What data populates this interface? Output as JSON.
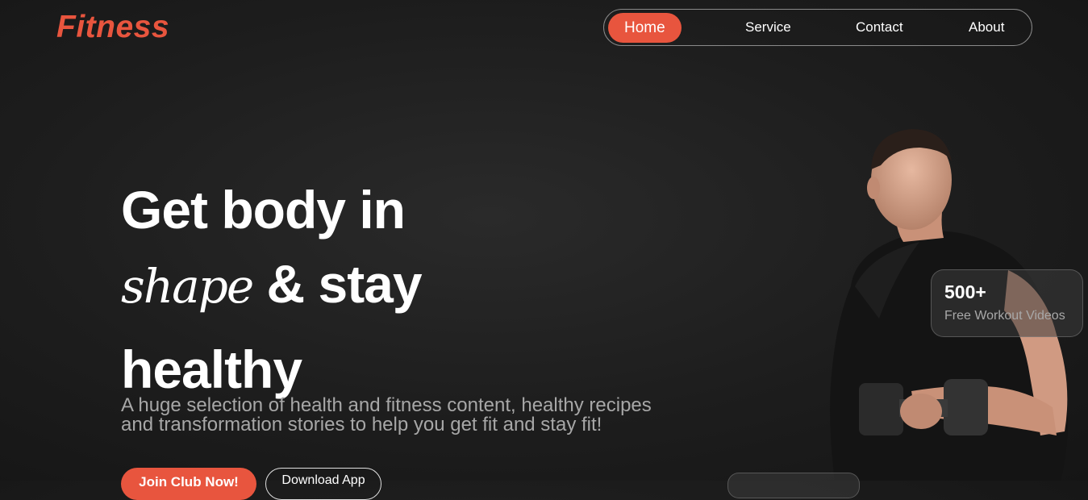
{
  "brand": {
    "logo_text": "Fitness",
    "accent_color": "#e8553e"
  },
  "nav": {
    "items": [
      {
        "label": "Home",
        "active": true
      },
      {
        "label": "Service",
        "active": false
      },
      {
        "label": "Contact",
        "active": false
      },
      {
        "label": "About",
        "active": false
      }
    ]
  },
  "hero": {
    "line1": "Get body in",
    "line2_script": "shape",
    "line2_rest": "& stay",
    "line3": "healthy",
    "description": "A huge selection of health and fitness content, healthy recipes and transformation stories to help you get fit and stay fit!",
    "primary_button": "Join Club Now!",
    "secondary_button": "Download App"
  },
  "stat_card": {
    "value": "500+",
    "label": "Free Workout Videos"
  }
}
